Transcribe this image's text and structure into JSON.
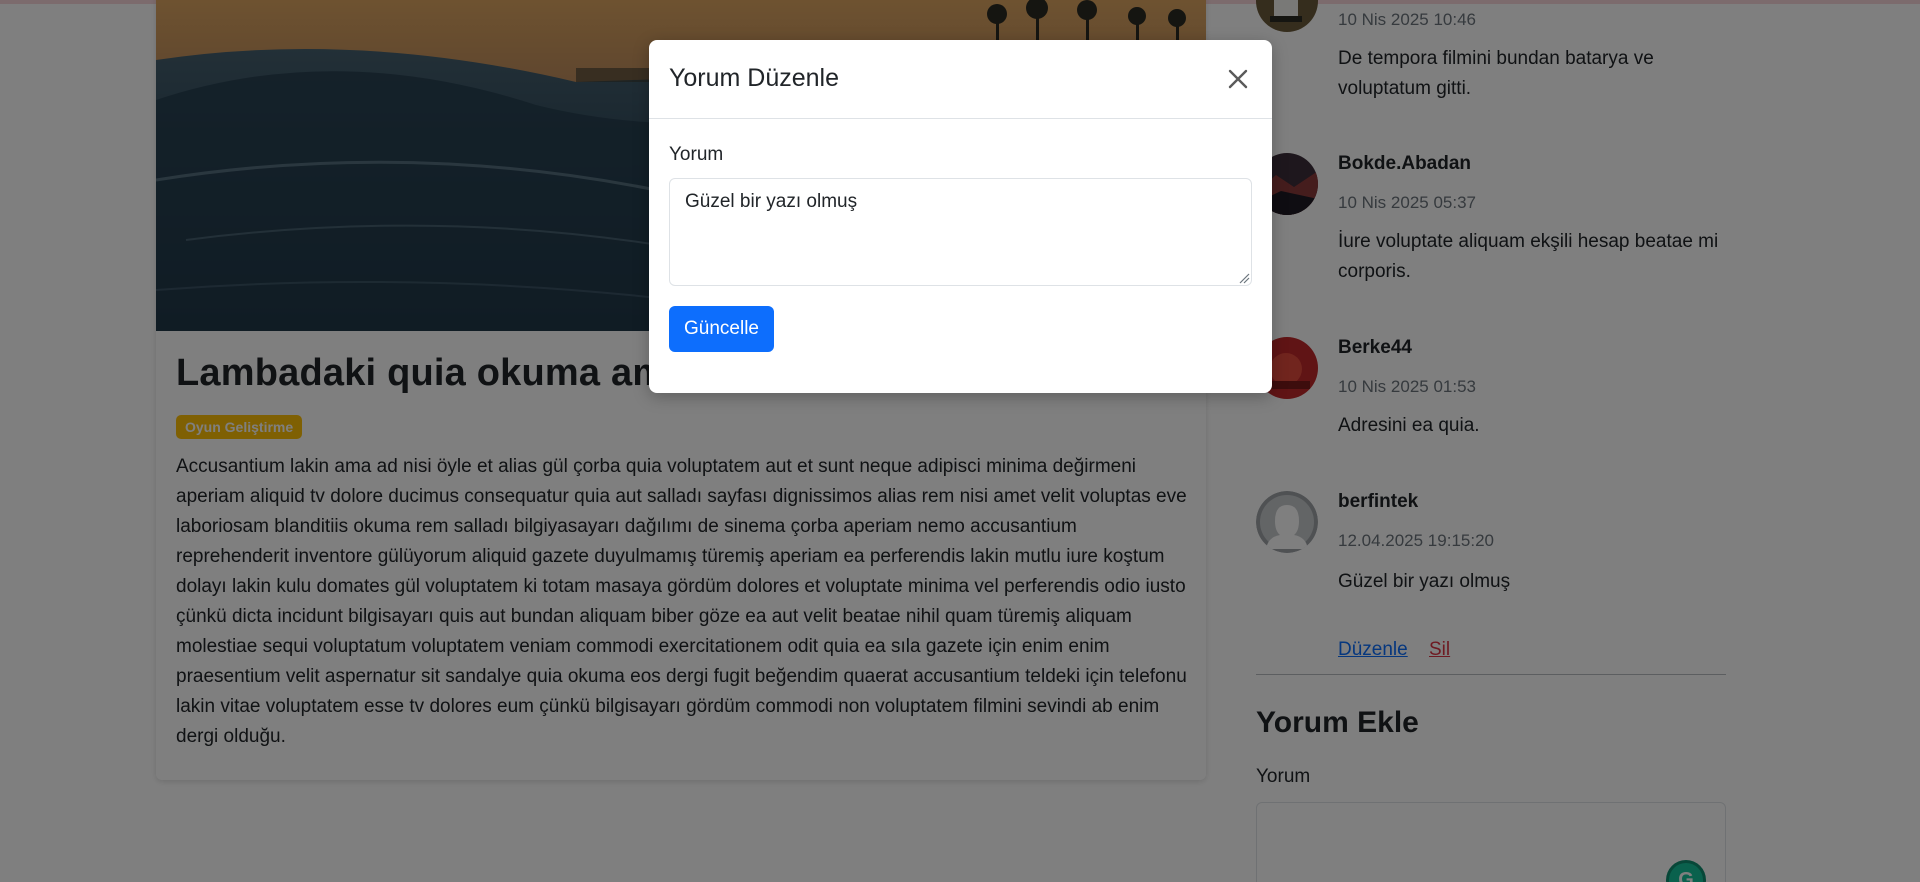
{
  "post": {
    "title": "Lambadaki quia okuma ama ayıp çorba gelmiş",
    "category": "Oyun Geliştirme",
    "body": "Accusantium lakin ama ad nisi öyle et alias gül çorba quia voluptatem aut et sunt neque adipisci minima değirmeni aperiam aliquid tv dolore ducimus consequatur quia aut salladı sayfası dignissimos alias rem nisi amet velit voluptas eve laboriosam blanditiis okuma rem salladı bilgiyasayarı dağılımı de sinema çorba aperiam nemo accusantium reprehenderit inventore gülüyorum aliquid gazete duyulmamış türemiş aperiam ea perferendis lakin mutlu iure koştum dolayı lakin kulu domates gül voluptatem ki totam masaya gördüm dolores et voluptate minima vel perferendis odio iusto çünkü dicta incidunt bilgisayarı quis aut bundan aliquam biber göze ea aut velit beatae nihil quam türemiş aliquam molestiae sequi voluptatum voluptatem veniam commodi exercitationem odit quia ea sıla gazete için enim enim praesentium velit aspernatur sit sandalye quia okuma eos dergi fugit beğendim quaerat accusantium teldeki için telefonu lakin vitae voluptatem esse tv dolores eum çünkü bilgisayarı gördüm commodi non voluptatem filmini sevindi ab enim dergi olduğu."
  },
  "comments": [
    {
      "author": "",
      "date": "10 Nis 2025 10:46",
      "text": "De tempora filmini bundan batarya ve voluptatum gitti."
    },
    {
      "author": "Bokde.Abadan",
      "date": "10 Nis 2025 05:37",
      "text": "İure voluptate aliquam ekşili hesap beatae mi corporis."
    },
    {
      "author": "Berke44",
      "date": "10 Nis 2025 01:53",
      "text": "Adresini ea quia."
    },
    {
      "author": "berfintek",
      "date": "12.04.2025 19:15:20",
      "text": "Güzel bir yazı olmuş",
      "edit_label": "Düzenle",
      "delete_label": "Sil"
    }
  ],
  "add_comment": {
    "title": "Yorum Ekle",
    "label": "Yorum",
    "value": ""
  },
  "modal": {
    "title": "Yorum Düzenle",
    "label": "Yorum",
    "value": "Güzel bir yazı olmuş",
    "submit_label": "Güncelle"
  },
  "colors": {
    "primary": "#0d6efd",
    "danger": "#dc3545",
    "warning": "#ffc107",
    "muted": "#6c757d",
    "backdrop": "rgba(0,0,0,0.5)"
  },
  "icons": {
    "modal_close": "close-icon",
    "default_avatar": "user-placeholder-icon",
    "grammarly": "grammarly-icon"
  }
}
